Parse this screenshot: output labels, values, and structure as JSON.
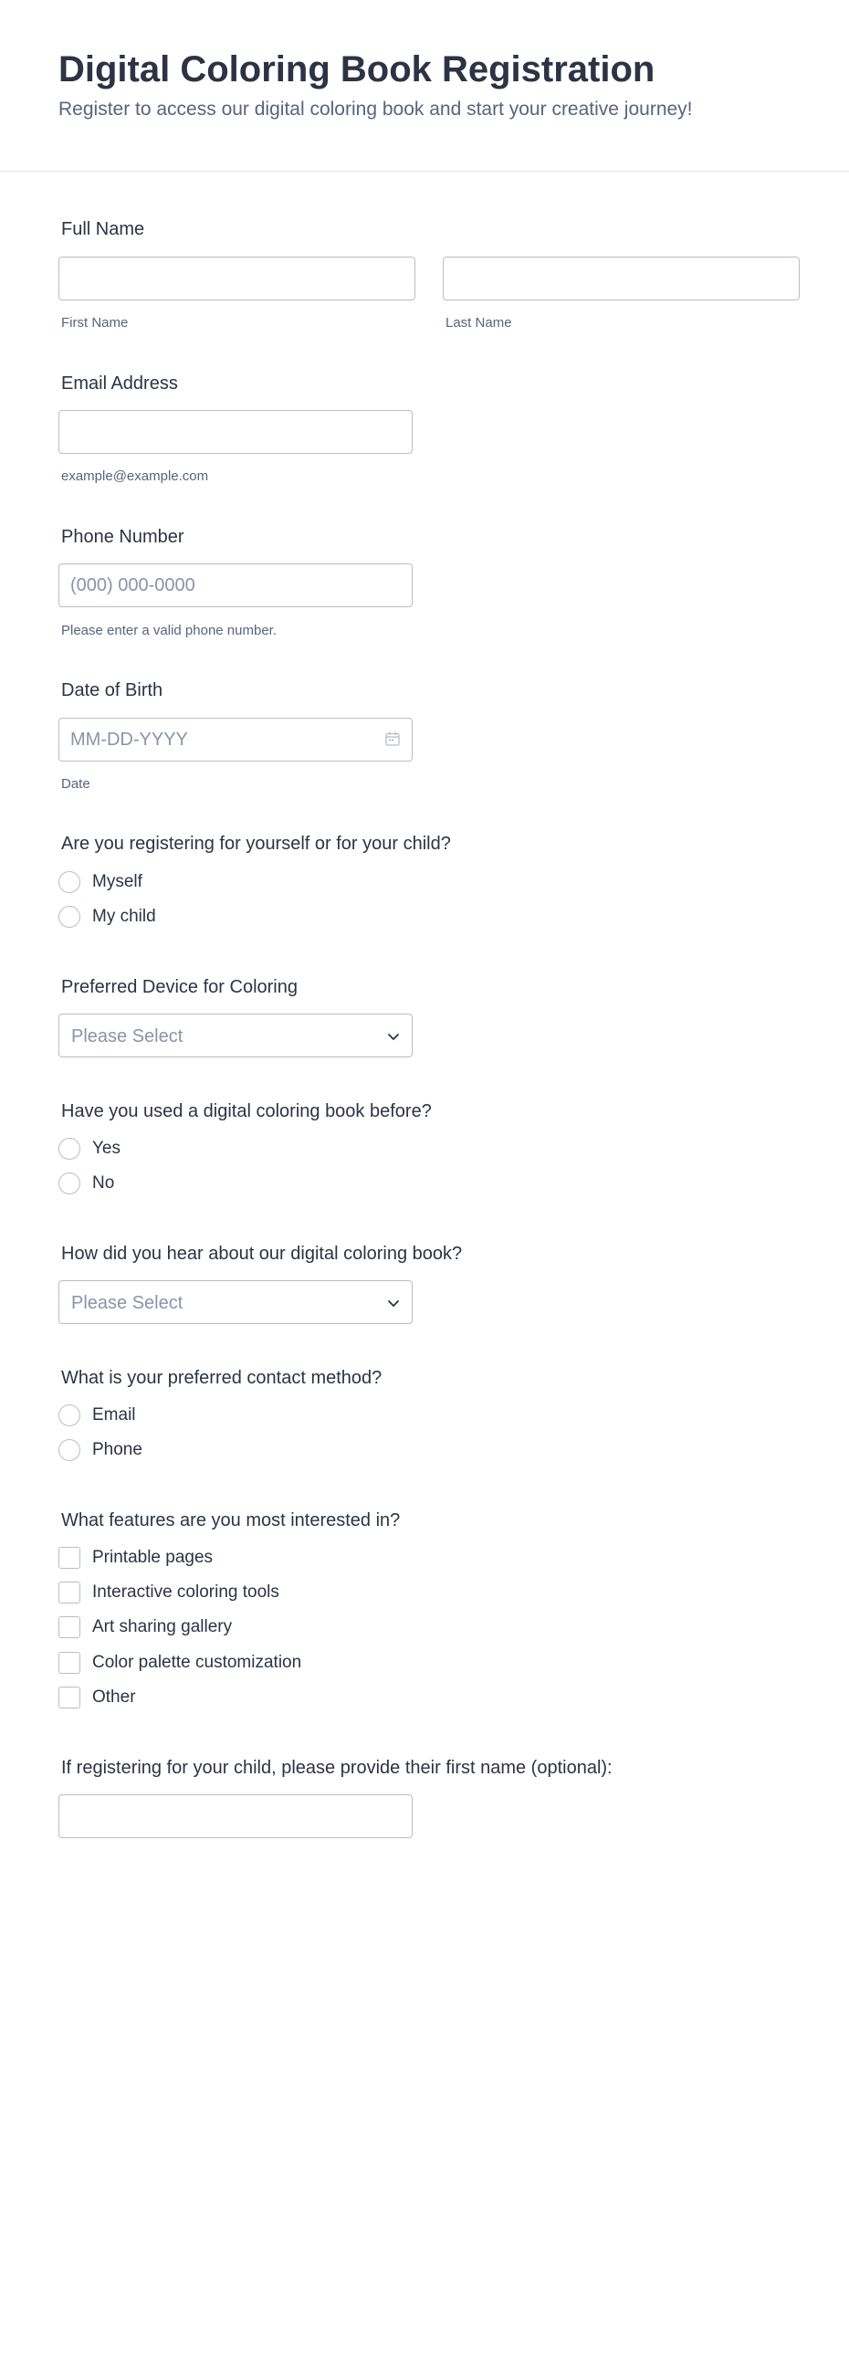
{
  "header": {
    "title": "Digital Coloring Book Registration",
    "subtitle": "Register to access our digital coloring book and start your creative journey!"
  },
  "full_name": {
    "label": "Full Name",
    "first_value": "",
    "last_value": "",
    "first_sublabel": "First Name",
    "last_sublabel": "Last Name"
  },
  "email": {
    "label": "Email Address",
    "value": "",
    "sublabel": "example@example.com"
  },
  "phone": {
    "label": "Phone Number",
    "placeholder": "(000) 000-0000",
    "sublabel": "Please enter a valid phone number."
  },
  "dob": {
    "label": "Date of Birth",
    "placeholder": "MM-DD-YYYY",
    "sublabel": "Date",
    "icon": "calendar-icon"
  },
  "registering_for": {
    "label": "Are you registering for yourself or for your child?",
    "options": [
      "Myself",
      "My child"
    ]
  },
  "device": {
    "label": "Preferred Device for Coloring",
    "placeholder": "Please Select"
  },
  "used_before": {
    "label": "Have you used a digital coloring book before?",
    "options": [
      "Yes",
      "No"
    ]
  },
  "heard_about": {
    "label": "How did you hear about our digital coloring book?",
    "placeholder": "Please Select"
  },
  "contact_method": {
    "label": "What is your preferred contact method?",
    "options": [
      "Email",
      "Phone"
    ]
  },
  "features": {
    "label": "What features are you most interested in?",
    "options": [
      "Printable pages",
      "Interactive coloring tools",
      "Art sharing gallery",
      "Color palette customization",
      "Other"
    ]
  },
  "child_name": {
    "label": "If registering for your child, please provide their first name (optional):",
    "value": ""
  },
  "colors": {
    "text": "#2c3345",
    "sublabel": "#57647e",
    "border": "#b8bdc9",
    "placeholder": "#8a93a8"
  }
}
